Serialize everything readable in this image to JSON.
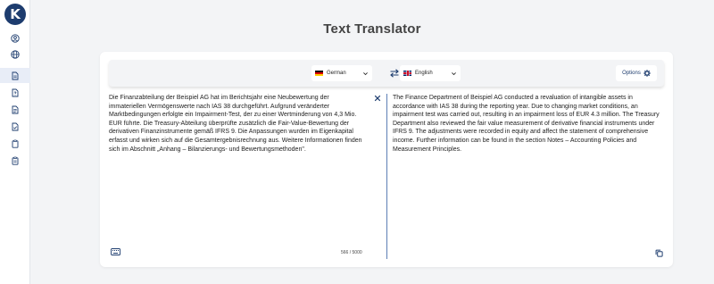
{
  "app": {
    "logo_letter": "K",
    "title": "Text Translator"
  },
  "sidebar": {
    "items": [
      {
        "icon": "user-circle-icon"
      },
      {
        "icon": "globe-icon"
      },
      {
        "icon": "document-icon",
        "active": true
      },
      {
        "icon": "document-question-icon"
      },
      {
        "icon": "document-text-icon"
      },
      {
        "icon": "document-check-icon"
      },
      {
        "icon": "clipboard-icon"
      },
      {
        "icon": "clipboard-list-icon"
      }
    ]
  },
  "toolbar": {
    "source_language": "German",
    "target_language": "English",
    "options_label": "Options"
  },
  "source": {
    "text": "Die Finanzabteilung der Beispiel AG hat im Berichtsjahr eine Neubewertung der immateriellen Vermögenswerte nach IAS 38 durchgeführt. Aufgrund veränderter Marktbedingungen erfolgte ein Impairment-Test, der zu einer Wertminderung von 4,3 Mio. EUR führte. Die Treasury-Abteilung überprüfte zusätzlich die Fair-Value-Bewertung der derivativen Finanzinstrumente gemäß IFRS 9. Die Anpassungen wurden im Eigenkapital erfasst und wirken sich auf die Gesamtergebnisrechnung aus. Weitere Informationen finden sich im Abschnitt „Anhang – Bilanzierungs- und Bewertungsmethoden\".",
    "char_count": "566 / 5000"
  },
  "target": {
    "text": "The Finance Department of Beispiel AG conducted a revaluation of intangible assets in accordance with IAS 38 during the reporting year. Due to changing market conditions, an impairment test was carried out, resulting in an impairment loss of EUR 4.3 million. The Treasury Department also reviewed the fair value measurement of derivative financial instruments under IFRS 9. The adjustments were recorded in equity and affect the statement of comprehensive income. Further information can be found in the section Notes – Accounting Policies and Measurement Principles."
  },
  "colors": {
    "brand": "#1d3c6e",
    "divider": "#5d7fb5",
    "background": "#f3f4f6"
  }
}
